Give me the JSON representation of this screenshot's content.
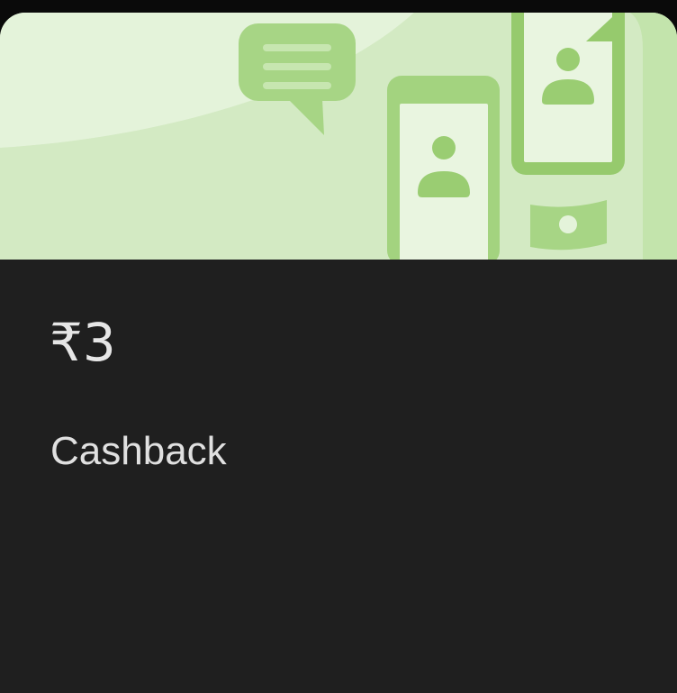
{
  "reward_card": {
    "amount": "₹3",
    "reward_type": "Cashback",
    "illustration": {
      "icons": [
        "chat-bubble-icon",
        "phone-contact-icon",
        "phone-contact-icon",
        "banknote-icon"
      ],
      "colors": {
        "background": "#d4ebc4",
        "background_light": "#e4f3da",
        "accent": "#a3d37f",
        "accent_dark": "#96ca6d",
        "screen": "#e9f5e0"
      }
    },
    "colors": {
      "card_background": "#1f1f1f",
      "text_primary": "#e6e6e6"
    }
  }
}
